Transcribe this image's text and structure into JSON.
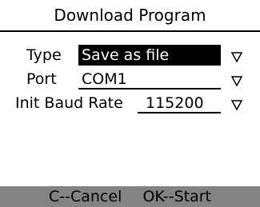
{
  "title": "Download Program",
  "fields": [
    {
      "label": "Type",
      "value": "Save as file",
      "selected": true
    },
    {
      "label": "Port",
      "value": "COM1",
      "selected": false
    },
    {
      "label": "Init Baud Rate",
      "value": "115200",
      "selected": false
    }
  ],
  "footer": {
    "cancel": "C--Cancel",
    "start": "OK--Start"
  },
  "colors": {
    "background": "#ffffff",
    "text": "#000000",
    "selection": "#000000",
    "footer_bar": "#838383"
  },
  "icons": {
    "dropdown": "dropdown-triangle-icon"
  }
}
